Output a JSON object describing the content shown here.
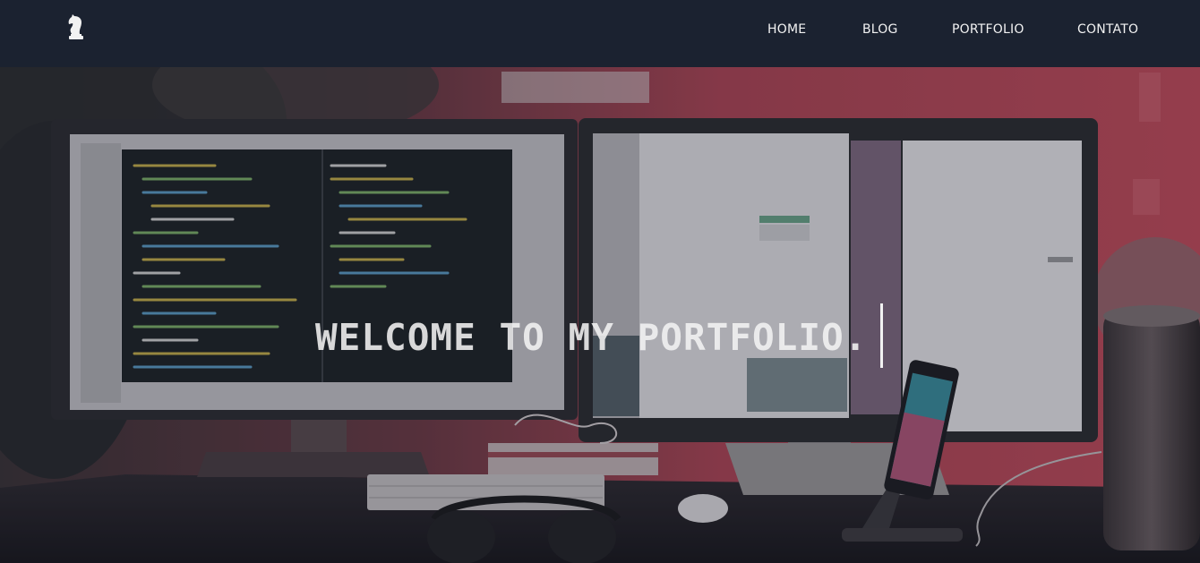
{
  "navbar": {
    "logo_icon": "chess-knight-icon",
    "links": [
      "HOME",
      "BLOG",
      "PORTFOLIO",
      "CONTATO"
    ]
  },
  "hero": {
    "title": "WELCOME TO MY PORTFOLIO.",
    "background": "desk-with-dual-monitors-photo",
    "caret_icon": "text-cursor"
  },
  "colors": {
    "navbar_bg": "#1b2230",
    "nav_text": "#f2f2f2",
    "wall_red": "#a8404f",
    "title_text": "#f2f2f2"
  }
}
